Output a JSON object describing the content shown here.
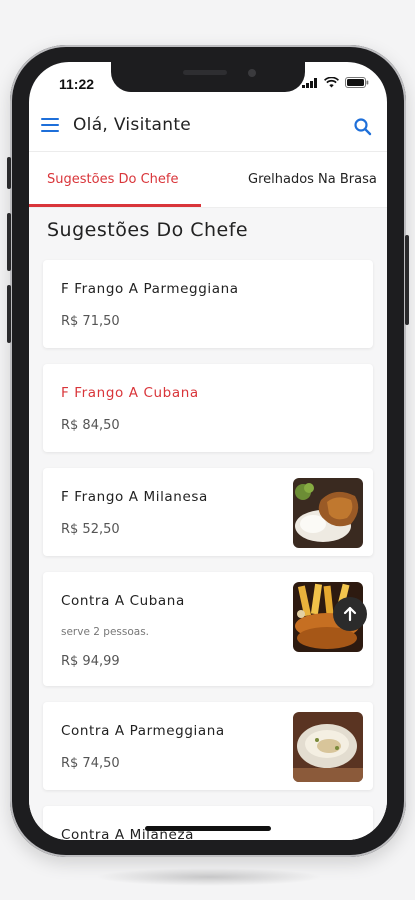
{
  "status_bar": {
    "time": "11:22"
  },
  "header": {
    "greeting": "Olá, Visitante"
  },
  "tabs": [
    {
      "label": "Sugestões Do Chefe",
      "active": true
    },
    {
      "label": "Grelhados Na Brasa",
      "active": false
    }
  ],
  "section": {
    "title": "Sugestões Do Chefe"
  },
  "items": [
    {
      "name": "F Frango A Parmeggiana",
      "price": "R$ 71,50"
    },
    {
      "name": "F Frango A Cubana",
      "price": "R$ 84,50"
    },
    {
      "name": "F Frango A Milanesa",
      "price": "R$ 52,50"
    },
    {
      "name": "Contra A Cubana",
      "description": "serve 2 pessoas.",
      "price": "R$ 94,99"
    },
    {
      "name": "Contra A Parmeggiana",
      "price": "R$ 74,50"
    },
    {
      "name": "Contra A Milaneza"
    }
  ],
  "colors": {
    "accent": "#d9353a",
    "link": "#1e6fd9"
  }
}
